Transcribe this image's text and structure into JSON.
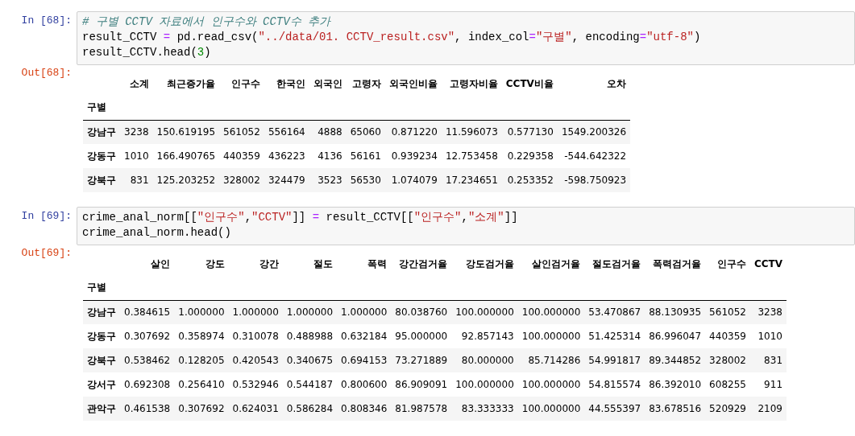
{
  "cells": [
    {
      "in_prompt": "In [68]:",
      "code": [
        [
          {
            "kind": "comment",
            "text": "# 구별 CCTV 자료에서 인구수와 CCTV수 추가"
          }
        ],
        [
          {
            "kind": "plain",
            "text": "result_CCTV "
          },
          {
            "kind": "operator",
            "text": "="
          },
          {
            "kind": "plain",
            "text": " pd.read_csv("
          },
          {
            "kind": "string",
            "text": "\"../data/01. CCTV_result.csv\""
          },
          {
            "kind": "plain",
            "text": ", index_col"
          },
          {
            "kind": "operator",
            "text": "="
          },
          {
            "kind": "string",
            "text": "\"구별\""
          },
          {
            "kind": "plain",
            "text": ", encoding"
          },
          {
            "kind": "operator",
            "text": "="
          },
          {
            "kind": "string",
            "text": "\"utf-8\""
          },
          {
            "kind": "plain",
            "text": ")"
          }
        ],
        [
          {
            "kind": "plain",
            "text": "result_CCTV.head("
          },
          {
            "kind": "number",
            "text": "3"
          },
          {
            "kind": "plain",
            "text": ")"
          }
        ]
      ],
      "out_prompt": "Out[68]:",
      "table": {
        "columns": [
          "소계",
          "최근증가율",
          "인구수",
          "한국인",
          "외국인",
          "고령자",
          "외국인비율",
          "고령자비율",
          "CCTV비율",
          "오차"
        ],
        "index_name": "구별",
        "rows": [
          {
            "index": "강남구",
            "values": [
              "3238",
              "150.619195",
              "561052",
              "556164",
              "4888",
              "65060",
              "0.871220",
              "11.596073",
              "0.577130",
              "1549.200326"
            ]
          },
          {
            "index": "강동구",
            "values": [
              "1010",
              "166.490765",
              "440359",
              "436223",
              "4136",
              "56161",
              "0.939234",
              "12.753458",
              "0.229358",
              "-544.642322"
            ]
          },
          {
            "index": "강북구",
            "values": [
              "831",
              "125.203252",
              "328002",
              "324479",
              "3523",
              "56530",
              "1.074079",
              "17.234651",
              "0.253352",
              "-598.750923"
            ]
          }
        ]
      }
    },
    {
      "in_prompt": "In [69]:",
      "code": [
        [
          {
            "kind": "plain",
            "text": "crime_anal_norm[["
          },
          {
            "kind": "string",
            "text": "\"인구수\""
          },
          {
            "kind": "plain",
            "text": ","
          },
          {
            "kind": "string",
            "text": "\"CCTV\""
          },
          {
            "kind": "plain",
            "text": "]] "
          },
          {
            "kind": "operator",
            "text": "="
          },
          {
            "kind": "plain",
            "text": " result_CCTV[["
          },
          {
            "kind": "string",
            "text": "\"인구수\""
          },
          {
            "kind": "plain",
            "text": ","
          },
          {
            "kind": "string",
            "text": "\"소계\""
          },
          {
            "kind": "plain",
            "text": "]]"
          }
        ],
        [
          {
            "kind": "plain",
            "text": "crime_anal_norm.head()"
          }
        ]
      ],
      "out_prompt": "Out[69]:",
      "table": {
        "columns": [
          "살인",
          "강도",
          "강간",
          "절도",
          "폭력",
          "강간검거율",
          "강도검거율",
          "살인검거율",
          "절도검거율",
          "폭력검거율",
          "인구수",
          "CCTV"
        ],
        "index_name": "구별",
        "rows": [
          {
            "index": "강남구",
            "values": [
              "0.384615",
              "1.000000",
              "1.000000",
              "1.000000",
              "1.000000",
              "80.038760",
              "100.000000",
              "100.000000",
              "53.470867",
              "88.130935",
              "561052",
              "3238"
            ]
          },
          {
            "index": "강동구",
            "values": [
              "0.307692",
              "0.358974",
              "0.310078",
              "0.488988",
              "0.632184",
              "95.000000",
              "92.857143",
              "100.000000",
              "51.425314",
              "86.996047",
              "440359",
              "1010"
            ]
          },
          {
            "index": "강북구",
            "values": [
              "0.538462",
              "0.128205",
              "0.420543",
              "0.340675",
              "0.694153",
              "73.271889",
              "80.000000",
              "85.714286",
              "54.991817",
              "89.344852",
              "328002",
              "831"
            ]
          },
          {
            "index": "강서구",
            "values": [
              "0.692308",
              "0.256410",
              "0.532946",
              "0.544187",
              "0.800600",
              "86.909091",
              "100.000000",
              "100.000000",
              "54.815574",
              "86.392010",
              "608255",
              "911"
            ]
          },
          {
            "index": "관악구",
            "values": [
              "0.461538",
              "0.307692",
              "0.624031",
              "0.586284",
              "0.808346",
              "81.987578",
              "83.333333",
              "100.000000",
              "44.555397",
              "83.678516",
              "520929",
              "2109"
            ]
          }
        ]
      }
    }
  ]
}
